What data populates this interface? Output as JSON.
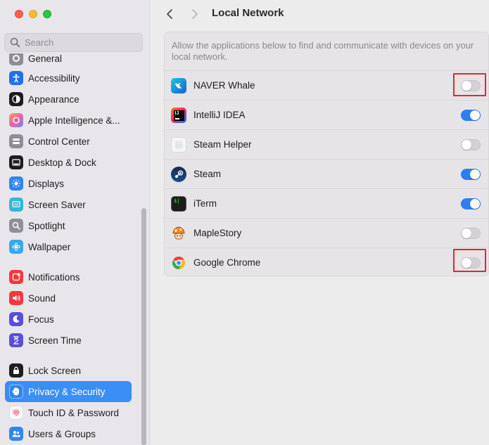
{
  "window": {
    "traffic_lights": [
      "close",
      "minimize",
      "zoom"
    ]
  },
  "sidebar": {
    "search_placeholder": "Search",
    "partial_item": "General",
    "items": [
      {
        "label": "Accessibility",
        "icon": "accessibility-icon",
        "color": "#1f6ff0"
      },
      {
        "label": "Appearance",
        "icon": "appearance-icon",
        "color": "#1d1d1f"
      },
      {
        "label": "Apple Intelligence &...",
        "icon": "apple-intelligence-icon",
        "color": "#f06ab0"
      },
      {
        "label": "Control Center",
        "icon": "control-center-icon",
        "color": "#8e8e93"
      },
      {
        "label": "Desktop & Dock",
        "icon": "dock-icon",
        "color": "#1d1d1f"
      },
      {
        "label": "Displays",
        "icon": "displays-icon",
        "color": "#2f86f2"
      },
      {
        "label": "Screen Saver",
        "icon": "screen-saver-icon",
        "color": "#33b7d9"
      },
      {
        "label": "Spotlight",
        "icon": "spotlight-icon",
        "color": "#8e8e93"
      },
      {
        "label": "Wallpaper",
        "icon": "wallpaper-icon",
        "color": "#37a9e8"
      },
      {
        "label": "Notifications",
        "icon": "notifications-icon",
        "color": "#f0393e"
      },
      {
        "label": "Sound",
        "icon": "sound-icon",
        "color": "#f0393e"
      },
      {
        "label": "Focus",
        "icon": "focus-icon",
        "color": "#5b4fd6"
      },
      {
        "label": "Screen Time",
        "icon": "screen-time-icon",
        "color": "#5b4fd6"
      },
      {
        "label": "Lock Screen",
        "icon": "lock-screen-icon",
        "color": "#1d1d1f"
      },
      {
        "label": "Privacy & Security",
        "icon": "privacy-hand-icon",
        "color": "#2f86f2",
        "active": true
      },
      {
        "label": "Touch ID & Password",
        "icon": "touch-id-icon",
        "color": "#f7f7f7"
      },
      {
        "label": "Users & Groups",
        "icon": "users-icon",
        "color": "#2f86f2"
      }
    ]
  },
  "main": {
    "title": "Local Network",
    "description": "Allow the applications below to find and communicate with devices on your local network.",
    "apps": [
      {
        "name": "NAVER Whale",
        "icon": "naver-whale-icon",
        "enabled": false,
        "highlighted": true
      },
      {
        "name": "IntelliJ IDEA",
        "icon": "intellij-icon",
        "enabled": true,
        "highlighted": false
      },
      {
        "name": "Steam Helper",
        "icon": "steam-helper-icon",
        "enabled": false,
        "highlighted": false
      },
      {
        "name": "Steam",
        "icon": "steam-icon",
        "enabled": true,
        "highlighted": false
      },
      {
        "name": "iTerm",
        "icon": "iterm-icon",
        "enabled": true,
        "highlighted": false
      },
      {
        "name": "MapleStory",
        "icon": "maplestory-icon",
        "enabled": false,
        "highlighted": false
      },
      {
        "name": "Google Chrome",
        "icon": "chrome-icon",
        "enabled": false,
        "highlighted": true
      }
    ]
  },
  "colors": {
    "accent": "#2f7ef0",
    "highlight_box": "#e0282e",
    "sidebar_active": "#3b8ef5"
  }
}
